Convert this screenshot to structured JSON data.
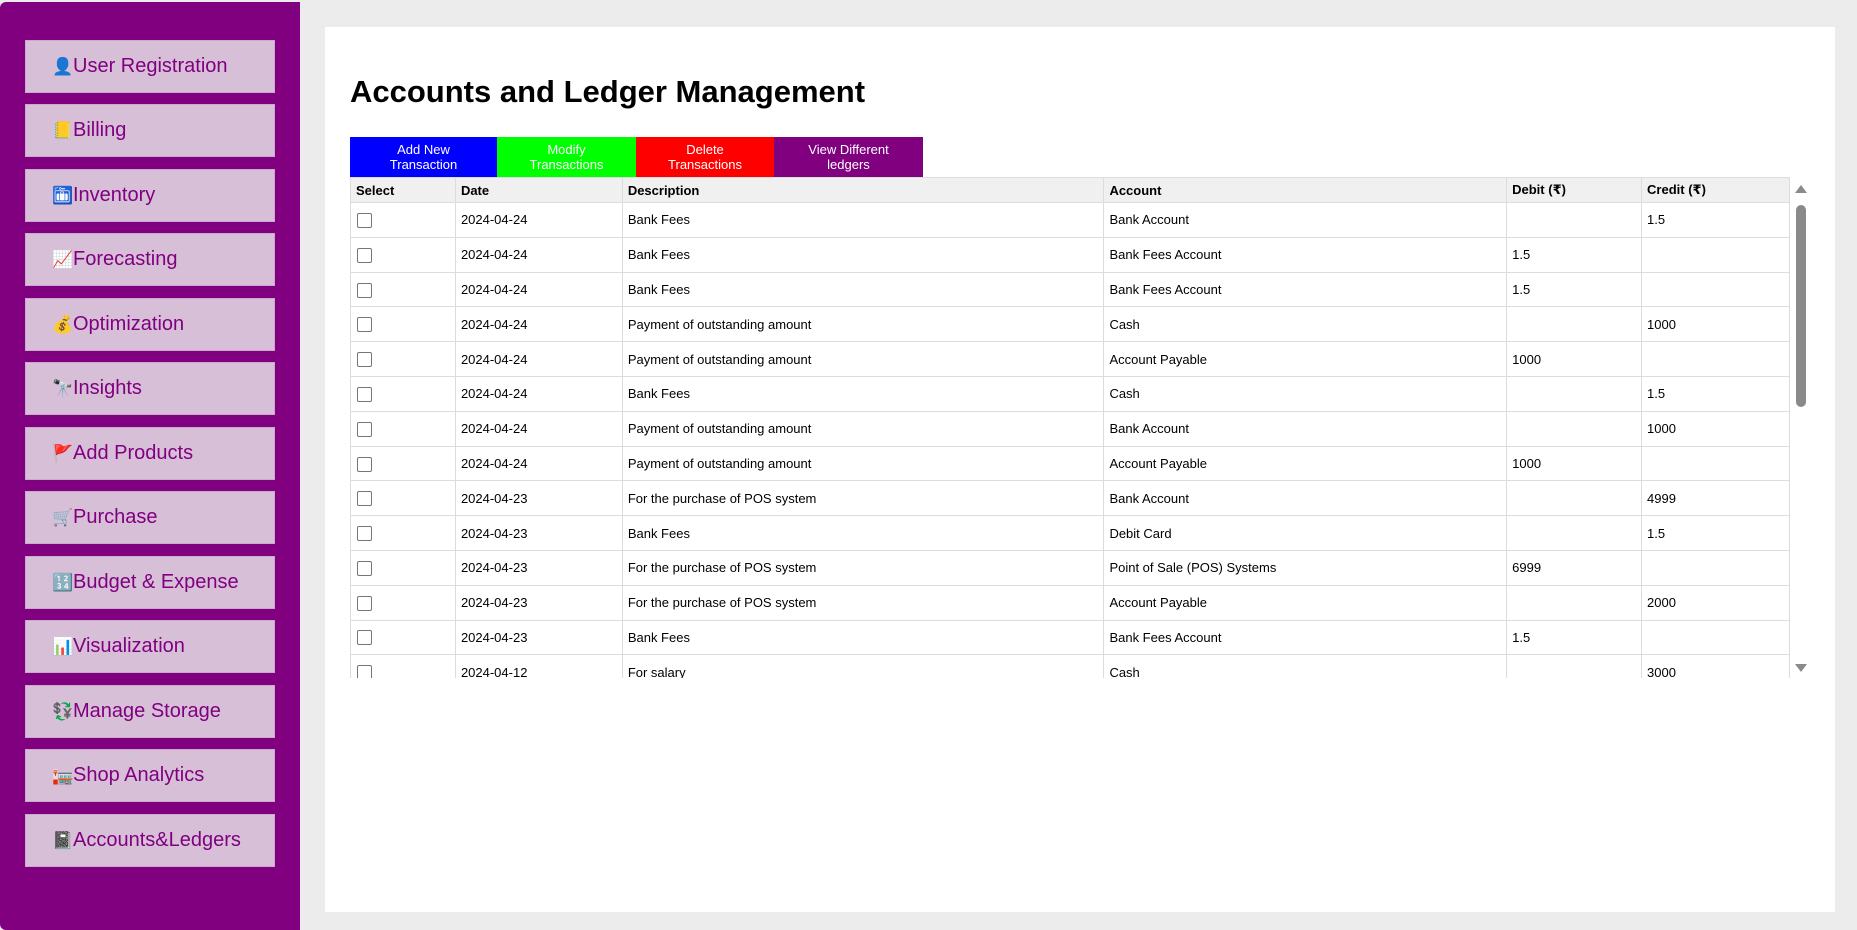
{
  "sidebar": {
    "items": [
      {
        "icon": "👤",
        "icon_name": "user-icon",
        "label": "User Registration"
      },
      {
        "icon": "📒",
        "icon_name": "ledger-book-icon",
        "label": "Billing"
      },
      {
        "icon": "🛅",
        "icon_name": "inventory-locker-icon",
        "label": "Inventory"
      },
      {
        "icon": "📈",
        "icon_name": "chart-increasing-icon",
        "label": "Forecasting"
      },
      {
        "icon": "💰",
        "icon_name": "money-bag-icon",
        "label": "Optimization"
      },
      {
        "icon": "🔭",
        "icon_name": "telescope-icon",
        "label": "Insights"
      },
      {
        "icon": "🚩",
        "icon_name": "red-flag-icon",
        "label": "Add Products"
      },
      {
        "icon": "🛒",
        "icon_name": "shopping-cart-icon",
        "label": "Purchase"
      },
      {
        "icon": "🔢",
        "icon_name": "numbers-icon",
        "label": "Budget & Expense"
      },
      {
        "icon": "📊",
        "icon_name": "bar-chart-icon",
        "label": "Visualization"
      },
      {
        "icon": "💱",
        "icon_name": "currency-exchange-icon",
        "label": "Manage Storage"
      },
      {
        "icon": "🏣",
        "icon_name": "shop-building-icon",
        "label": "Shop Analytics"
      },
      {
        "icon": "📓",
        "icon_name": "notebook-icon",
        "label": "Accounts&Ledgers"
      }
    ]
  },
  "main": {
    "title": "Accounts and Ledger Management",
    "buttons": {
      "add": "Add New Transaction",
      "modify": "Modify Transactions",
      "delete": "Delete Transactions",
      "view": "View Different ledgers"
    },
    "table": {
      "headers": {
        "select": "Select",
        "date": "Date",
        "description": "Description",
        "account": "Account",
        "debit": "Debit (₹)",
        "credit": "Credit (₹)"
      },
      "rows": [
        {
          "date": "2024-04-24",
          "description": "Bank Fees",
          "account": "Bank Account",
          "debit": "",
          "credit": "1.5"
        },
        {
          "date": "2024-04-24",
          "description": "Bank Fees",
          "account": "Bank Fees Account",
          "debit": "1.5",
          "credit": ""
        },
        {
          "date": "2024-04-24",
          "description": "Bank Fees",
          "account": "Bank Fees Account",
          "debit": "1.5",
          "credit": ""
        },
        {
          "date": "2024-04-24",
          "description": "Payment of outstanding amount",
          "account": "Cash",
          "debit": "",
          "credit": "1000"
        },
        {
          "date": "2024-04-24",
          "description": "Payment of outstanding amount",
          "account": "Account Payable",
          "debit": "1000",
          "credit": ""
        },
        {
          "date": "2024-04-24",
          "description": "Bank Fees",
          "account": "Cash",
          "debit": "",
          "credit": "1.5"
        },
        {
          "date": "2024-04-24",
          "description": "Payment of outstanding amount",
          "account": "Bank Account",
          "debit": "",
          "credit": "1000"
        },
        {
          "date": "2024-04-24",
          "description": "Payment of outstanding amount",
          "account": "Account Payable",
          "debit": "1000",
          "credit": ""
        },
        {
          "date": "2024-04-23",
          "description": "For the purchase of POS system",
          "account": "Bank Account",
          "debit": "",
          "credit": "4999"
        },
        {
          "date": "2024-04-23",
          "description": "Bank Fees",
          "account": "Debit Card",
          "debit": "",
          "credit": "1.5"
        },
        {
          "date": "2024-04-23",
          "description": "For the purchase of POS system",
          "account": "Point of Sale (POS) Systems",
          "debit": "6999",
          "credit": ""
        },
        {
          "date": "2024-04-23",
          "description": "For the purchase of POS system",
          "account": "Account Payable",
          "debit": "",
          "credit": "2000"
        },
        {
          "date": "2024-04-23",
          "description": "Bank Fees",
          "account": "Bank Fees Account",
          "debit": "1.5",
          "credit": ""
        },
        {
          "date": "2024-04-12",
          "description": "For salary",
          "account": "Cash",
          "debit": "",
          "credit": "3000"
        }
      ]
    }
  },
  "colors": {
    "sidebar_bg": "#800080",
    "nav_item_bg": "#d8bfd8",
    "nav_item_text": "#800080",
    "btn_add": "#0000ff",
    "btn_modify": "#00ff00",
    "btn_delete": "#ff0000",
    "btn_view": "#800080"
  }
}
